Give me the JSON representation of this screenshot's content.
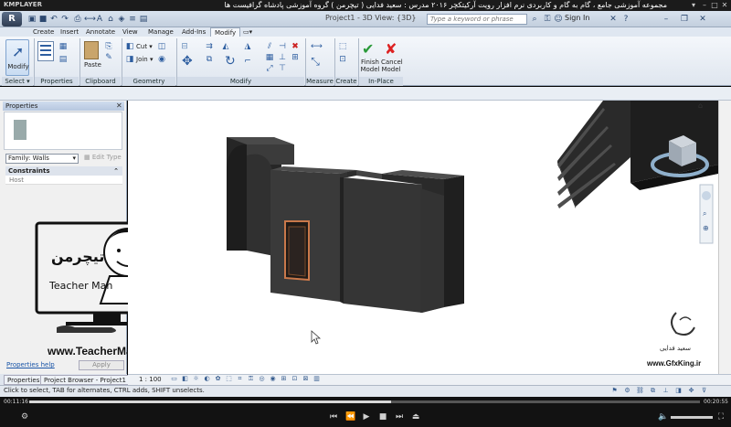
{
  "player": {
    "logo": "KMPLAYER",
    "title": "مجموعه آموزشی جامع ، گام به گام و کاربردی نرم افزار رویت آرکیتکچر ۲۰۱۶   مدرس : سعید فدایی ( تیچرمن ) گروه آموزشی پادشاه گرافیست ها",
    "time_elapsed": "00:11:16",
    "time_total": "00:20:55",
    "progress_fraction": 0.54
  },
  "revit": {
    "app_button": "R",
    "doc_title": "Project1 - 3D View: {3D}",
    "search_placeholder": "Type a keyword or phrase",
    "sign_in": "Sign In"
  },
  "ribbon": {
    "tabs": [
      "Create",
      "Insert",
      "Annotate",
      "View",
      "Manage",
      "Add-Ins",
      "Modify"
    ],
    "active_tab": "Modify",
    "modify_label": "Modify",
    "select_label": "Select",
    "properties_label": "Properties",
    "clipboard_label": "Clipboard",
    "paste_label": "Paste",
    "geometry_label": "Geometry",
    "cut_label": "Cut",
    "join_label": "Join",
    "modify_panel_label": "Modify",
    "measure_label": "Measure",
    "create_label": "Create",
    "inplace_label": "In-Place Editor",
    "finish_model": "Finish Model",
    "cancel_model": "Cancel Model"
  },
  "properties": {
    "header": "Properties",
    "family": "Family: Walls",
    "edit_type": "Edit Type",
    "constraints": "Constraints",
    "host": "Host",
    "help": "Properties help",
    "apply": "Apply",
    "tab_properties": "Properties",
    "tab_browser": "Project Browser - Project1"
  },
  "view_control": {
    "scale": "1 : 100"
  },
  "status": {
    "text": "Click to select, TAB for alternates, CTRL adds, SHIFT unselects."
  },
  "watermark": {
    "teacherman_name": "Teacher Man",
    "teacherman_url": "www.TeacherMan.ir",
    "gfx_name": "سعید فدایی",
    "gfx_url": "www.GfxKing.ir"
  },
  "colors": {
    "wall": "#3a3a3a",
    "wall_dark": "#262626",
    "door_frame": "#b86a3a",
    "ribbon_bg": "#e6ecf3",
    "accent": "#2e5ea0"
  }
}
